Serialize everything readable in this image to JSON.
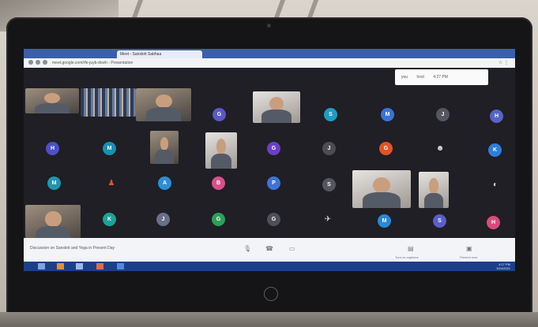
{
  "browser": {
    "tab_title": "Meet - Sanskrit Sabhaa",
    "url": "meet.google.com/rfe-juyb-dvwh - Presentation"
  },
  "notification": {
    "items": [
      "you",
      "host",
      "4:27 PM"
    ]
  },
  "grid": {
    "avatars": [
      {
        "letter": "G",
        "color": "#5b57c9"
      },
      {
        "letter": "S",
        "color": "#1f9cc2"
      },
      {
        "letter": "M",
        "color": "#3a72d8"
      },
      {
        "letter": "J",
        "color": "#55565f"
      },
      {
        "letter": "H",
        "color": "#5764c4"
      },
      {
        "letter": "H",
        "color": "#4d4fc5"
      },
      {
        "letter": "M",
        "color": "#1a8fb0"
      },
      {
        "letter": "G",
        "color": "#6c3fc4"
      },
      {
        "letter": "J",
        "color": "#4c4c52"
      },
      {
        "letter": "G",
        "color": "#e0542a"
      },
      {
        "letter": "K",
        "color": "#2f7ed8"
      },
      {
        "letter": "M",
        "color": "#1f96ad"
      },
      {
        "letter": "A",
        "color": "#2c8fd6"
      },
      {
        "letter": "B",
        "color": "#d8508b"
      },
      {
        "letter": "P",
        "color": "#3f72d6"
      },
      {
        "letter": "S",
        "color": "#55565f"
      },
      {
        "letter": "K",
        "color": "#1ca29a"
      },
      {
        "letter": "J",
        "color": "#6a6f88"
      },
      {
        "letter": "G",
        "color": "#2e9e58"
      },
      {
        "letter": "G",
        "color": "#4e4f57"
      },
      {
        "letter": "M",
        "color": "#2a88d4"
      },
      {
        "letter": "S",
        "color": "#5a5ec8"
      },
      {
        "letter": "H",
        "color": "#d84b7a"
      }
    ]
  },
  "controls": {
    "meeting_title": "Discussion on Sanskrit and Yoga in Present Day",
    "present_label": "Present now",
    "captions_label": "Turn on captions"
  },
  "clock": {
    "time": "4:27 PM",
    "date": "3/24/2021"
  },
  "brand": {
    "logo": "hp"
  }
}
